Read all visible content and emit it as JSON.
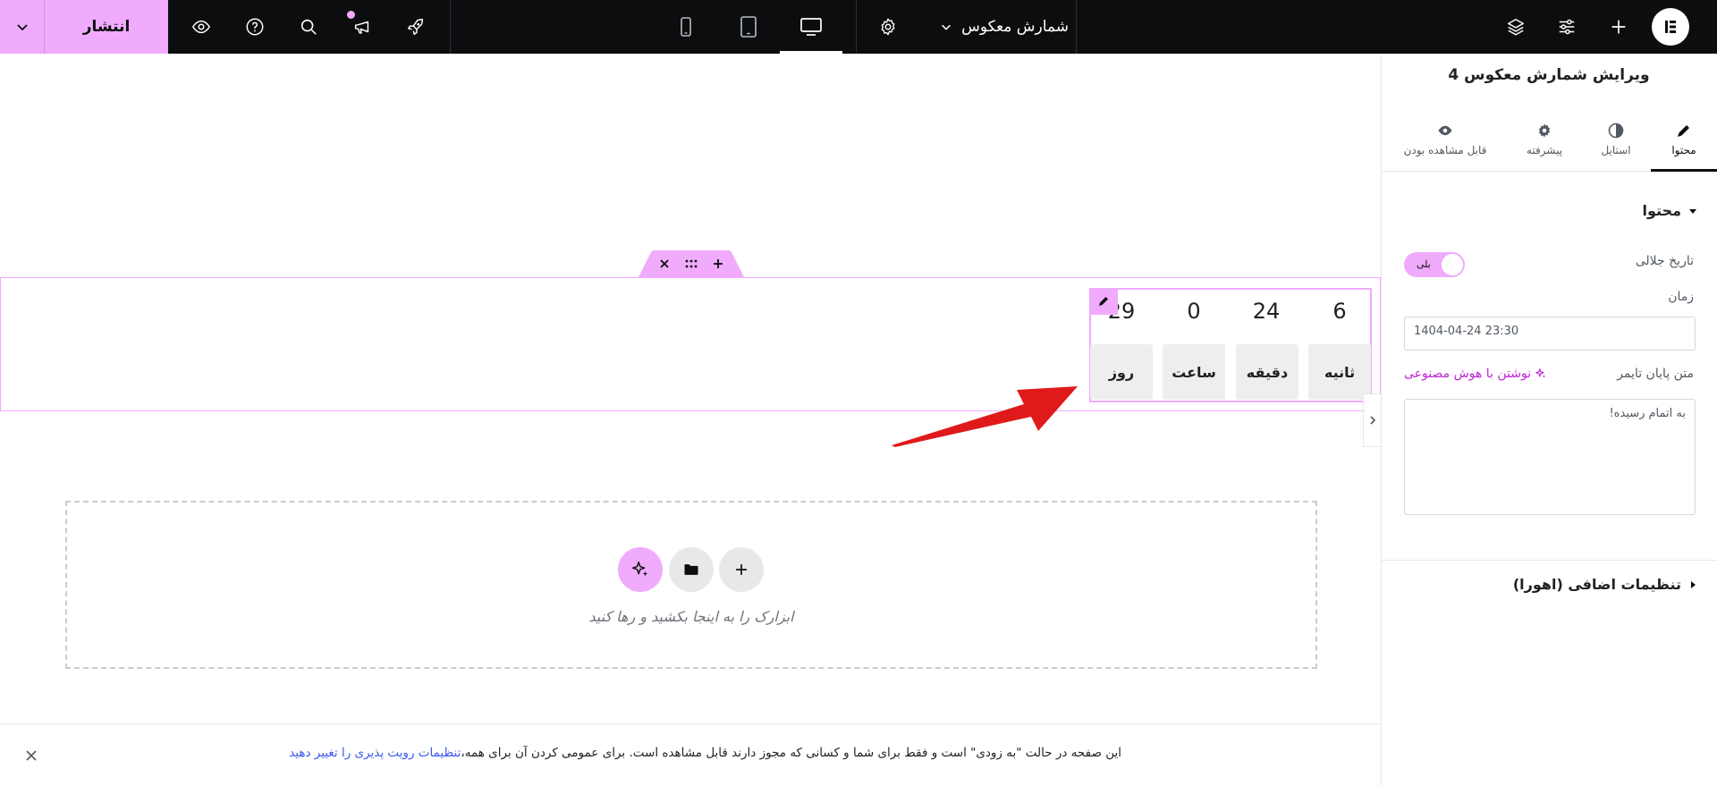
{
  "topbar": {
    "publish_label": "انتشار",
    "page_title": "شمارش معکوس",
    "devices": [
      "desktop",
      "tablet",
      "mobile"
    ],
    "active_device": "desktop",
    "accent_color": "#f0abfc"
  },
  "canvas": {
    "countdown": {
      "numbers": [
        "6",
        "24",
        "0",
        "29"
      ],
      "labels": [
        "ثانیه",
        "دقیقه",
        "ساعت",
        "روز"
      ]
    },
    "dropzone_text": "ابزارک را به اینجا بکشید و رها کنید",
    "notice": {
      "text": "این صفحه در حالت \"به زودی\" است و فقط برای شما و کسانی که مجوز دارند قابل مشاهده است. برای عمومی کردن آن برای همه،",
      "link": "تنظیمات رویت پذیری را تغییر دهید"
    }
  },
  "panel": {
    "title": "ویرایش شمارش معکوس 4",
    "tabs": [
      {
        "label": "محتوا",
        "icon": "pencil-icon"
      },
      {
        "label": "استایل",
        "icon": "half-circle-icon"
      },
      {
        "label": "پیشرفته",
        "icon": "gear-icon"
      },
      {
        "label": "قابل مشاهده بودن",
        "icon": "eye-icon"
      }
    ],
    "active_tab": "محتوا",
    "section_title": "محتوا",
    "jalali_label": "تاریخ جلالی",
    "jalali_toggle": "بلی",
    "time_label": "زمان",
    "time_value": "1404-04-24 23:30",
    "end_text_label": "متن پایان تایمر",
    "ai_link": "نوشتن با هوش مصنوعی",
    "end_text_value": "به اتمام رسیده!",
    "extra_section": "تنظیمات اضافی (اهورا)"
  }
}
